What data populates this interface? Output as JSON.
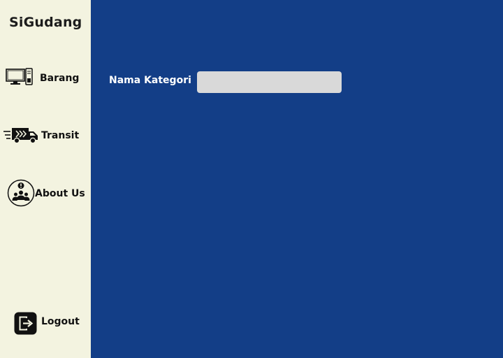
{
  "sidebar": {
    "brand": "SiGudang",
    "items": [
      {
        "label": "Barang",
        "icon": "computer-icon"
      },
      {
        "label": "Transit",
        "icon": "delivery-truck-icon"
      },
      {
        "label": "About Us",
        "icon": "about-us-icon"
      },
      {
        "label": "Logout",
        "icon": "logout-icon"
      }
    ]
  },
  "form": {
    "label": "Nama Kategori",
    "value": "",
    "placeholder": ""
  },
  "colors": {
    "sidebar_bg": "#f3f3e0",
    "main_bg": "#133e87",
    "input_bg": "#d9d9d9"
  }
}
